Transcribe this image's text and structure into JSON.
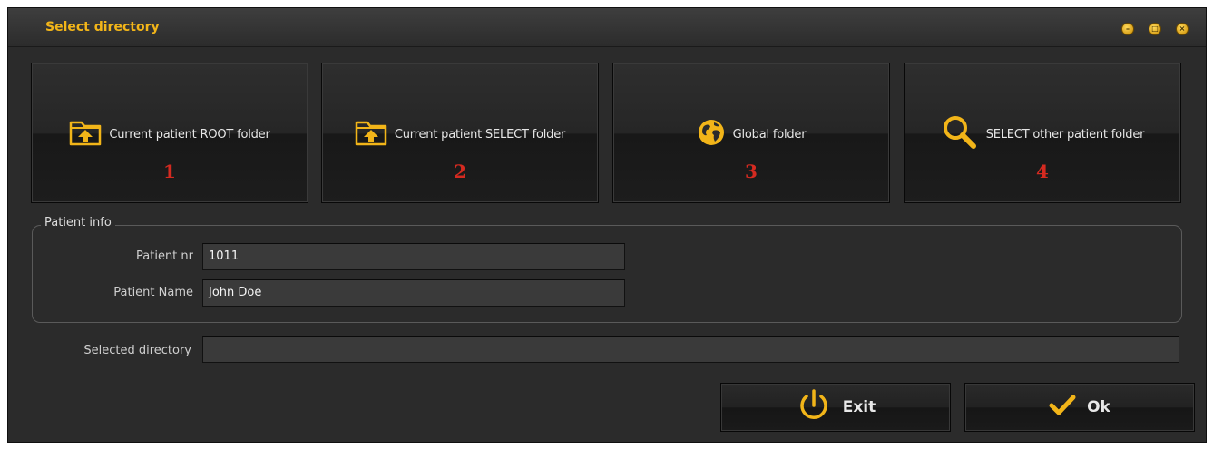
{
  "window": {
    "title": "Select directory",
    "controls": [
      "minimize-icon",
      "maximize-icon",
      "close-icon"
    ],
    "accent": "#f2b519"
  },
  "tiles": [
    {
      "label": "Current patient ROOT folder",
      "number": "1",
      "icon": "folder-upload-icon"
    },
    {
      "label": "Current patient SELECT folder",
      "number": "2",
      "icon": "folder-upload-icon"
    },
    {
      "label": "Global folder",
      "number": "3",
      "icon": "globe-icon"
    },
    {
      "label": "SELECT other patient folder",
      "number": "4",
      "icon": "search-icon"
    }
  ],
  "patient_info": {
    "legend": "Patient info",
    "nr_label": "Patient nr",
    "nr_value": "1011",
    "name_label": "Patient Name",
    "name_value": "John Doe"
  },
  "selected_directory": {
    "label": "Selected directory",
    "value": ""
  },
  "buttons": {
    "exit_label": "Exit",
    "ok_label": "Ok"
  },
  "colors": {
    "number_red": "#d42a20",
    "icon_yellow": "#f2b519"
  }
}
